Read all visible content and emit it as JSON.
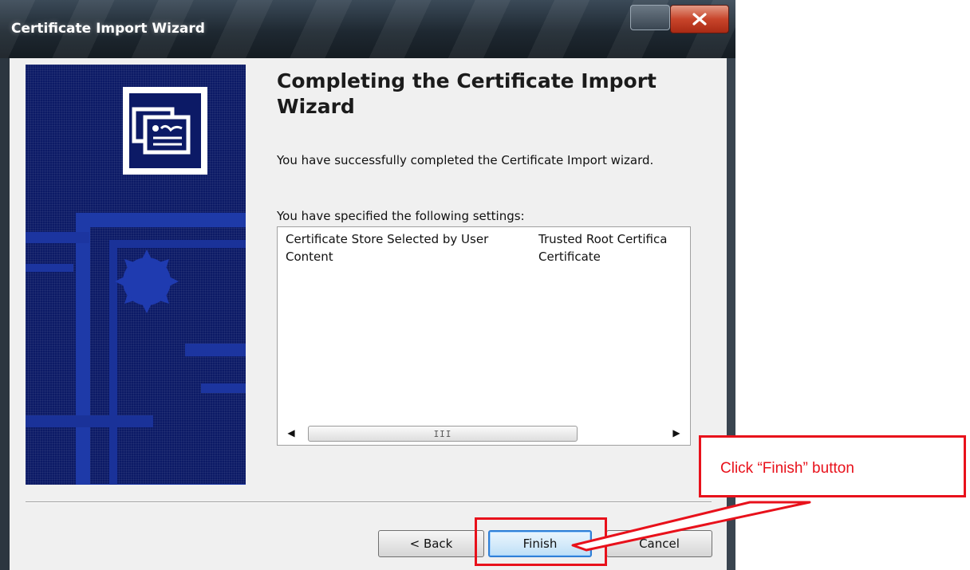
{
  "window": {
    "title": "Certificate Import Wizard",
    "close_icon": "close-icon"
  },
  "wizard": {
    "heading": "Completing the Certificate Import Wizard",
    "description": "You have successfully completed the Certificate Import wizard.",
    "settings_label": "You have specified the following settings:",
    "settings_rows": [
      {
        "name": "Certificate Store Selected by User",
        "value": "Trusted Root Certifica"
      },
      {
        "name": "Content",
        "value": "Certificate"
      }
    ],
    "scrollbar_grip": "III"
  },
  "buttons": {
    "back": "< Back",
    "finish": "Finish",
    "cancel": "Cancel"
  },
  "annotation": {
    "text": "Click “Finish” button",
    "color": "#e8111b"
  },
  "colors": {
    "banner": "#0c1a66",
    "dialog_bg": "#f0f0f0"
  }
}
